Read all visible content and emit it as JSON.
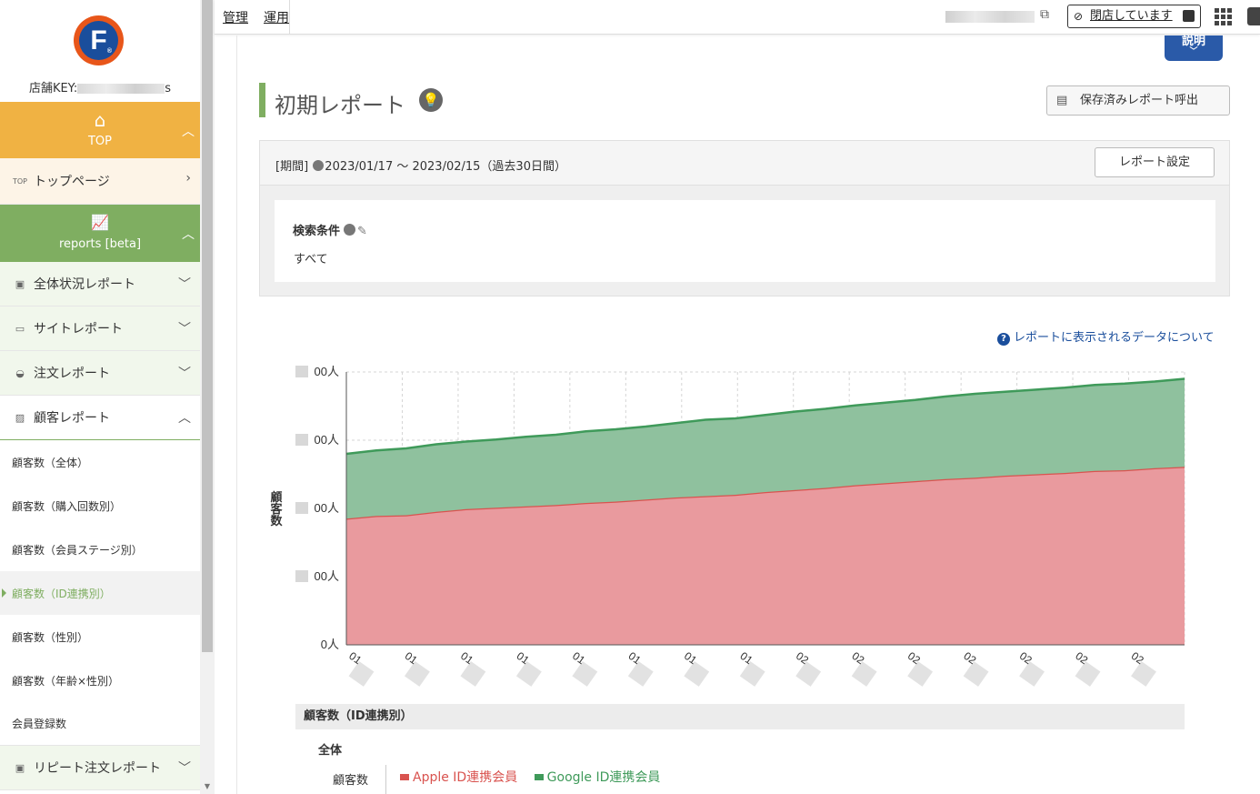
{
  "sidebar": {
    "store_key_prefix": "店舗KEY:",
    "store_key_suffix": "s",
    "top_section": "TOP",
    "top_page": "トップページ",
    "top_page_icon_text": "TOP",
    "reports_section": "reports [beta]",
    "menus": [
      "全体状況レポート",
      "サイトレポート",
      "注文レポート",
      "顧客レポート",
      "リピート注文レポート"
    ],
    "customer_subitems": [
      "顧客数（全体）",
      "顧客数（購入回数別）",
      "顧客数（会員ステージ別）",
      "顧客数（ID連携別）",
      "顧客数（性別）",
      "顧客数（年齢×性別）",
      "会員登録数"
    ],
    "active_subitem_index": 3
  },
  "topbar": {
    "manage": "管理",
    "operate": "運用",
    "closed_status": "閉店しています"
  },
  "main": {
    "help_badge": "説明",
    "title": "初期レポート",
    "saved_report_button": "保存済みレポート呼出",
    "period_label": "[期間]",
    "period_value": "2023/01/17 ～ 2023/02/15（過去30日間）",
    "report_settings_button": "レポート設定",
    "condition_label": "検索条件",
    "condition_value": "すべて",
    "data_link": "レポートに表示されるデータについて",
    "table_header": "顧客数（ID連携別）",
    "total_label": "全体",
    "count_label": "顧客数"
  },
  "chart_data": {
    "type": "area",
    "stacked": true,
    "ylabel": "顧客数",
    "y_tick_labels": [
      "0人",
      "00人",
      "00人",
      "00人",
      "00人"
    ],
    "ylim": [
      0,
      4
    ],
    "x_tick_labels_partial": [
      "01",
      "01",
      "01",
      "01",
      "01",
      "01",
      "01",
      "01",
      "02",
      "02",
      "02",
      "02",
      "02",
      "02",
      "02"
    ],
    "grid": true,
    "series": [
      {
        "name": "Apple ID連携会員",
        "color": "#e99a9e",
        "line_color": "#d9534f",
        "values": [
          1.85,
          1.89,
          1.9,
          1.95,
          1.99,
          2.01,
          2.03,
          2.05,
          2.08,
          2.1,
          2.13,
          2.16,
          2.18,
          2.2,
          2.24,
          2.27,
          2.3,
          2.34,
          2.37,
          2.4,
          2.43,
          2.45,
          2.48,
          2.5,
          2.52,
          2.55,
          2.56,
          2.59,
          2.61
        ]
      },
      {
        "name": "Google ID連携会員",
        "color": "#8fc19e",
        "line_color": "#3f9a5a",
        "values": [
          0.95,
          0.96,
          0.98,
          0.99,
          0.99,
          1.0,
          1.02,
          1.03,
          1.05,
          1.06,
          1.07,
          1.09,
          1.12,
          1.12,
          1.13,
          1.15,
          1.16,
          1.17,
          1.18,
          1.19,
          1.21,
          1.23,
          1.23,
          1.24,
          1.25,
          1.26,
          1.27,
          1.27,
          1.29
        ]
      }
    ]
  }
}
